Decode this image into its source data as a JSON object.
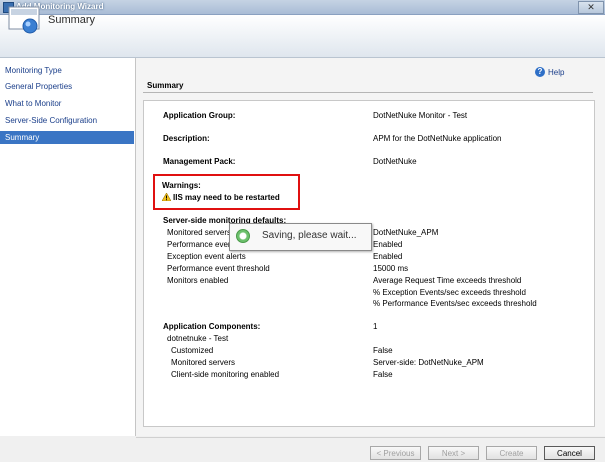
{
  "window": {
    "title": "Add Monitoring Wizard"
  },
  "header": {
    "title": "Summary"
  },
  "nav": {
    "items": [
      {
        "label": "Monitoring Type",
        "active": false
      },
      {
        "label": "General Properties",
        "active": false
      },
      {
        "label": "What to Monitor",
        "active": false
      },
      {
        "label": "Server-Side Configuration",
        "active": false
      },
      {
        "label": "Summary",
        "active": true
      }
    ]
  },
  "help": {
    "label": "Help"
  },
  "section": {
    "title": "Summary"
  },
  "summary": {
    "app_group_label": "Application Group:",
    "app_group_value": "DotNetNuke Monitor - Test",
    "description_label": "Description:",
    "description_value": "APM for the DotNetNuke application",
    "mp_label": "Management Pack:",
    "mp_value": "DotNetNuke",
    "warnings_label": "Warnings:",
    "warning_text": "IIS may need to be restarted",
    "defaults_label": "Server-side monitoring defaults:",
    "monitored_servers_label": "Monitored servers",
    "monitored_servers_value": "DotNetNuke_APM",
    "perf_events_label": "Performance events",
    "perf_events_value": "Enabled",
    "exception_alerts_label": "Exception event alerts",
    "exception_alerts_value": "Enabled",
    "perf_threshold_label": "Performance event threshold",
    "perf_threshold_value": "15000 ms",
    "monitors_label": "Monitors enabled",
    "monitors_values": [
      "Average Request Time exceeds threshold",
      "% Exception Events/sec exceeds threshold",
      "% Performance Events/sec exceeds threshold"
    ],
    "components_label": "Application Components:",
    "components_value": "1",
    "component_name": "dotnetnuke - Test",
    "customized_label": "Customized",
    "customized_value": "False",
    "comp_servers_label": "Monitored servers",
    "comp_servers_value": "Server-side: DotNetNuke_APM",
    "client_side_label": "Client-side monitoring enabled",
    "client_side_value": "False"
  },
  "saving": {
    "text": "Saving, please wait..."
  },
  "buttons": {
    "previous": "< Previous",
    "next": "Next >",
    "create": "Create",
    "cancel": "Cancel"
  },
  "colors": {
    "accent": "#3a75c4",
    "warning_border": "#e01010"
  }
}
